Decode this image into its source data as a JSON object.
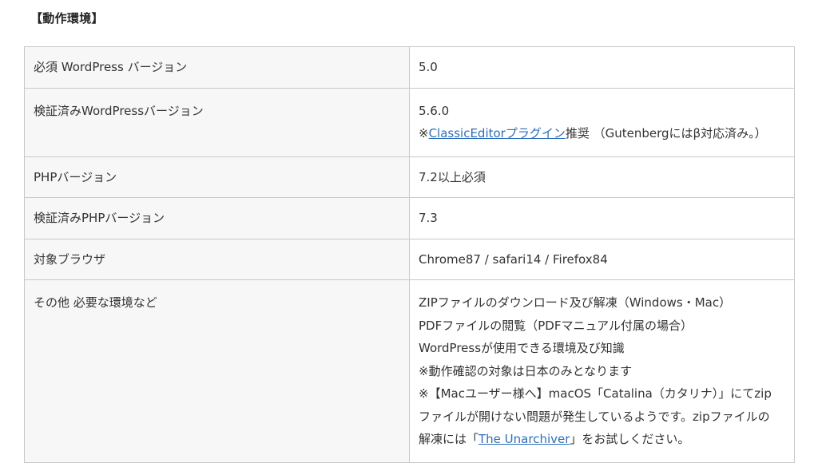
{
  "heading": "【動作環境】",
  "rows": [
    {
      "label": "必須 WordPress バージョン",
      "value": "5.0"
    },
    {
      "label": "検証済みWordPressバージョン",
      "value": "5.6.0",
      "note_prefix": "※",
      "note_link": "ClassicEditorプラグイン",
      "note_suffix": "推奨 （Gutenbergにはβ対応済み。）"
    },
    {
      "label": "PHPバージョン",
      "value": "7.2以上必須"
    },
    {
      "label": "検証済みPHPバージョン",
      "value": "7.3"
    },
    {
      "label": "対象ブラウザ",
      "value": "Chrome87 / safari14 / Firefox84"
    },
    {
      "label": "その他 必要な環境など",
      "lines": [
        "ZIPファイルのダウンロード及び解凍（Windows・Mac）",
        "PDFファイルの閲覧（PDFマニュアル付属の場合）",
        "WordPressが使用できる環境及び知識",
        "※動作確認の対象は日本のみとなります",
        "※【Macユーザー様へ】macOS「Catalina（カタリナ）」にてzip",
        "ファイルが開けない問題が発生しているようです。zipファイルの"
      ],
      "last_prefix": "解凍には「",
      "last_link": "The Unarchiver",
      "last_suffix": "」をお試しください。"
    }
  ]
}
